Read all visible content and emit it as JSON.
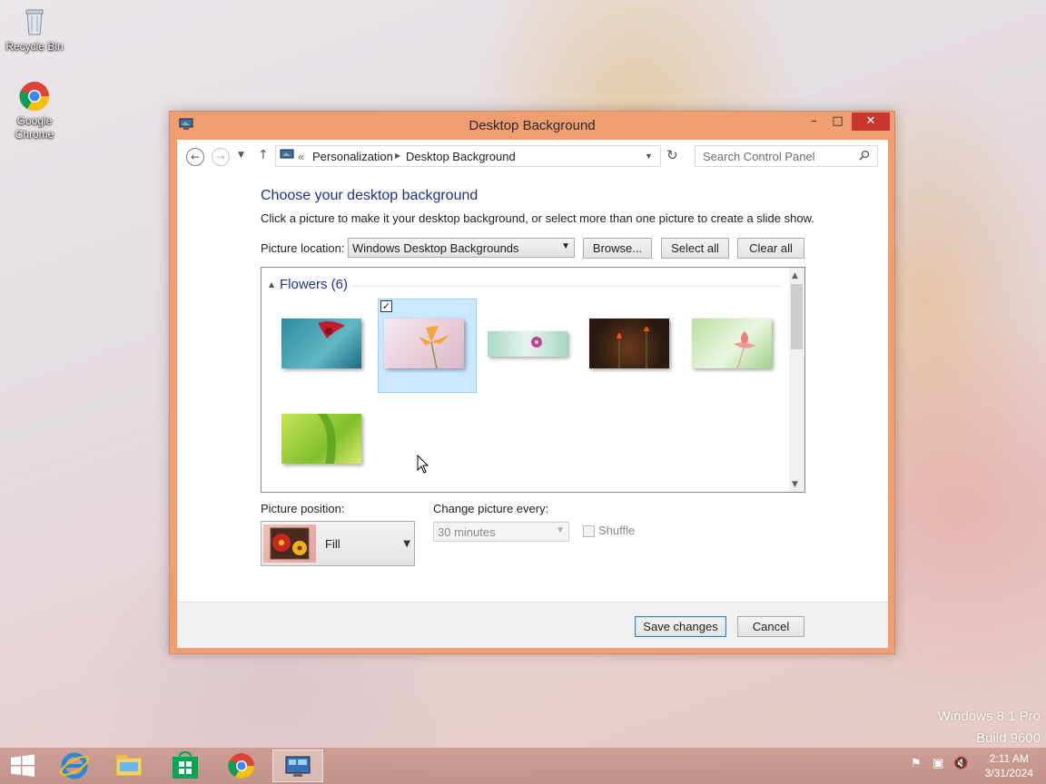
{
  "desktop": {
    "icons": [
      {
        "label": "Recycle Bin"
      },
      {
        "label": "Google Chrome"
      }
    ],
    "watermark_line1": "Windows 8.1 Pro",
    "watermark_line2": "Build 9600"
  },
  "window": {
    "title": "Desktop Background",
    "minimize_glyph": "–",
    "maximize_glyph": "□",
    "close_glyph": "✕",
    "address": {
      "prefix": "«",
      "crumb1": "Personalization",
      "crumb2": "Desktop Background"
    },
    "search_placeholder": "Search Control Panel",
    "heading": "Choose your desktop background",
    "description": "Click a picture to make it your desktop background, or select more than one picture to create a slide show.",
    "picture_location_label": "Picture location:",
    "picture_location_value": "Windows Desktop Backgrounds",
    "browse_label": "Browse...",
    "select_all_label": "Select all",
    "clear_all_label": "Clear all",
    "group_title": "Flowers (6)",
    "picture_position_label": "Picture position:",
    "picture_position_value": "Fill",
    "change_picture_label": "Change picture every:",
    "change_picture_value": "30 minutes",
    "shuffle_label": "Shuffle",
    "save_label": "Save changes",
    "cancel_label": "Cancel"
  },
  "taskbar": {
    "time": "2:11 AM",
    "date": "3/31/2024"
  },
  "colors": {
    "window_frame": "#ee9e71",
    "heading": "#1e3287",
    "selection": "#cce8ff",
    "close_button": "#c7372f"
  }
}
